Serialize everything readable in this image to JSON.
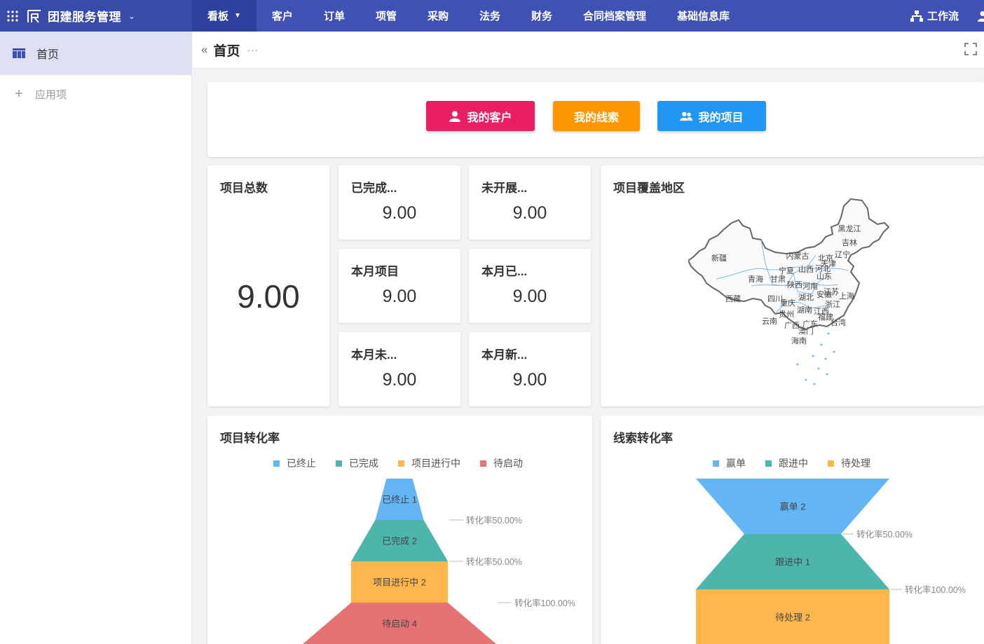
{
  "app": {
    "title": "团建服务管理"
  },
  "nav": {
    "items": [
      {
        "label": "看板"
      },
      {
        "label": "客户"
      },
      {
        "label": "订单"
      },
      {
        "label": "项管"
      },
      {
        "label": "采购"
      },
      {
        "label": "法务"
      },
      {
        "label": "财务"
      },
      {
        "label": "合同档案管理"
      },
      {
        "label": "基础信息库"
      }
    ],
    "workflow_label": "工作流"
  },
  "sidebar": {
    "home_label": "首页",
    "apps_label": "应用项"
  },
  "header": {
    "page_title": "首页",
    "more": "···"
  },
  "quick_buttons": [
    {
      "label": "我的客户",
      "color": "#e91e63"
    },
    {
      "label": "我的线索",
      "color": "#ff9800"
    },
    {
      "label": "我的项目",
      "color": "#2196f3"
    }
  ],
  "stats": {
    "total": {
      "title": "项目总数",
      "value": "9.00"
    },
    "cards": [
      {
        "title": "已完成...",
        "value": "9.00"
      },
      {
        "title": "未开展...",
        "value": "9.00"
      },
      {
        "title": "本月项目",
        "value": "9.00"
      },
      {
        "title": "本月已...",
        "value": "9.00"
      },
      {
        "title": "本月未...",
        "value": "9.00"
      },
      {
        "title": "本月新...",
        "value": "9.00"
      }
    ]
  },
  "map": {
    "title": "项目覆盖地区",
    "regions": [
      "黑龙江",
      "吉林",
      "辽宁",
      "内蒙古",
      "北京",
      "天津",
      "新疆",
      "宁夏",
      "山西",
      "河北",
      "山东",
      "青海",
      "甘肃",
      "陕西",
      "河南",
      "江苏",
      "西藏",
      "四川",
      "湖北",
      "安徽",
      "上海",
      "重庆",
      "浙江",
      "贵州",
      "湖南",
      "江西",
      "福建",
      "云南",
      "广西",
      "广东",
      "台湾",
      "澳门",
      "海南"
    ]
  },
  "project_funnel": {
    "title": "项目转化率",
    "chart_data": {
      "type": "funnel",
      "title": "项目转化率",
      "series": [
        {
          "name": "已终止",
          "value": 1,
          "color": "#64b5f6"
        },
        {
          "name": "已完成",
          "value": 2,
          "color": "#4db6ac"
        },
        {
          "name": "项目进行中",
          "value": 2,
          "color": "#ffb74d"
        },
        {
          "name": "待启动",
          "value": 4,
          "color": "#e57373"
        }
      ],
      "rates": [
        "转化率50.00%",
        "转化率50.00%",
        "转化率100.00%"
      ]
    }
  },
  "lead_funnel": {
    "title": "线索转化率",
    "chart_data": {
      "type": "funnel",
      "title": "线索转化率",
      "series": [
        {
          "name": "赢单",
          "value": 2,
          "color": "#64b5f6"
        },
        {
          "name": "跟进中",
          "value": 1,
          "color": "#4db6ac"
        },
        {
          "name": "待处理",
          "value": 2,
          "color": "#ffb74d"
        }
      ],
      "rates": [
        "转化率50.00%",
        "转化率100.00%"
      ]
    }
  }
}
